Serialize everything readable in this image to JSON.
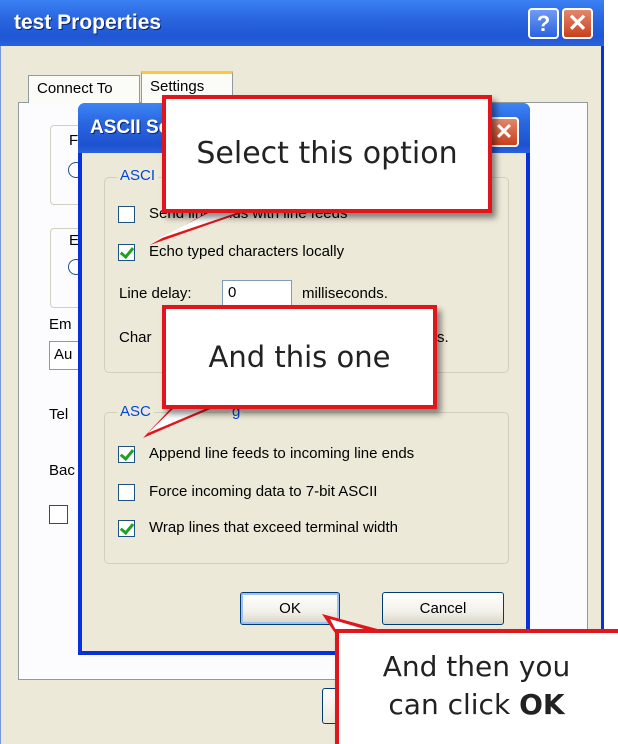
{
  "properties_window": {
    "title": "test Properties",
    "help_label": "?",
    "close_label": "✕",
    "tabs": [
      {
        "label": "Connect To"
      },
      {
        "label": "Settings"
      }
    ],
    "peek": {
      "group1_letter": "F",
      "group2_letter": "E",
      "emulation_label": "Em",
      "emulation_value": "Au",
      "telnet_label": "Tel",
      "backscroll_label": "Bac"
    }
  },
  "ascii_setup": {
    "title_partial": "ASCII Se",
    "close_label": "✕",
    "sending_group_label": "ASCI",
    "receiving_group_label": "ASC",
    "receiving_group_label_tail": "g",
    "send_line_ends_label": "Send line ends with line feeds",
    "echo_label": "Echo typed characters locally",
    "line_delay_label": "Line delay:",
    "line_delay_value": "0",
    "line_delay_unit": "milliseconds.",
    "char_delay_label_partial": "Char",
    "char_delay_tail": "s.",
    "append_label": "Append line feeds to incoming line ends",
    "force_label": "Force incoming data to 7-bit ASCII",
    "wrap_label": "Wrap lines that exceed terminal width",
    "checkbox_states": {
      "send_line_ends": false,
      "echo": true,
      "append": true,
      "force": false,
      "wrap": true
    },
    "ok_label": "OK",
    "cancel_label": "Cancel"
  },
  "callouts": {
    "first": "Select this option",
    "second": "And this one",
    "third_line1": "And then you",
    "third_line2_prefix": "can click ",
    "third_line2_bold": "OK"
  },
  "colors": {
    "titlebar": "#2a66e0",
    "dialog_face": "#ece9d8",
    "callout_border": "#e0161c",
    "group_label": "#0046d5",
    "check_mark": "#21a121"
  }
}
